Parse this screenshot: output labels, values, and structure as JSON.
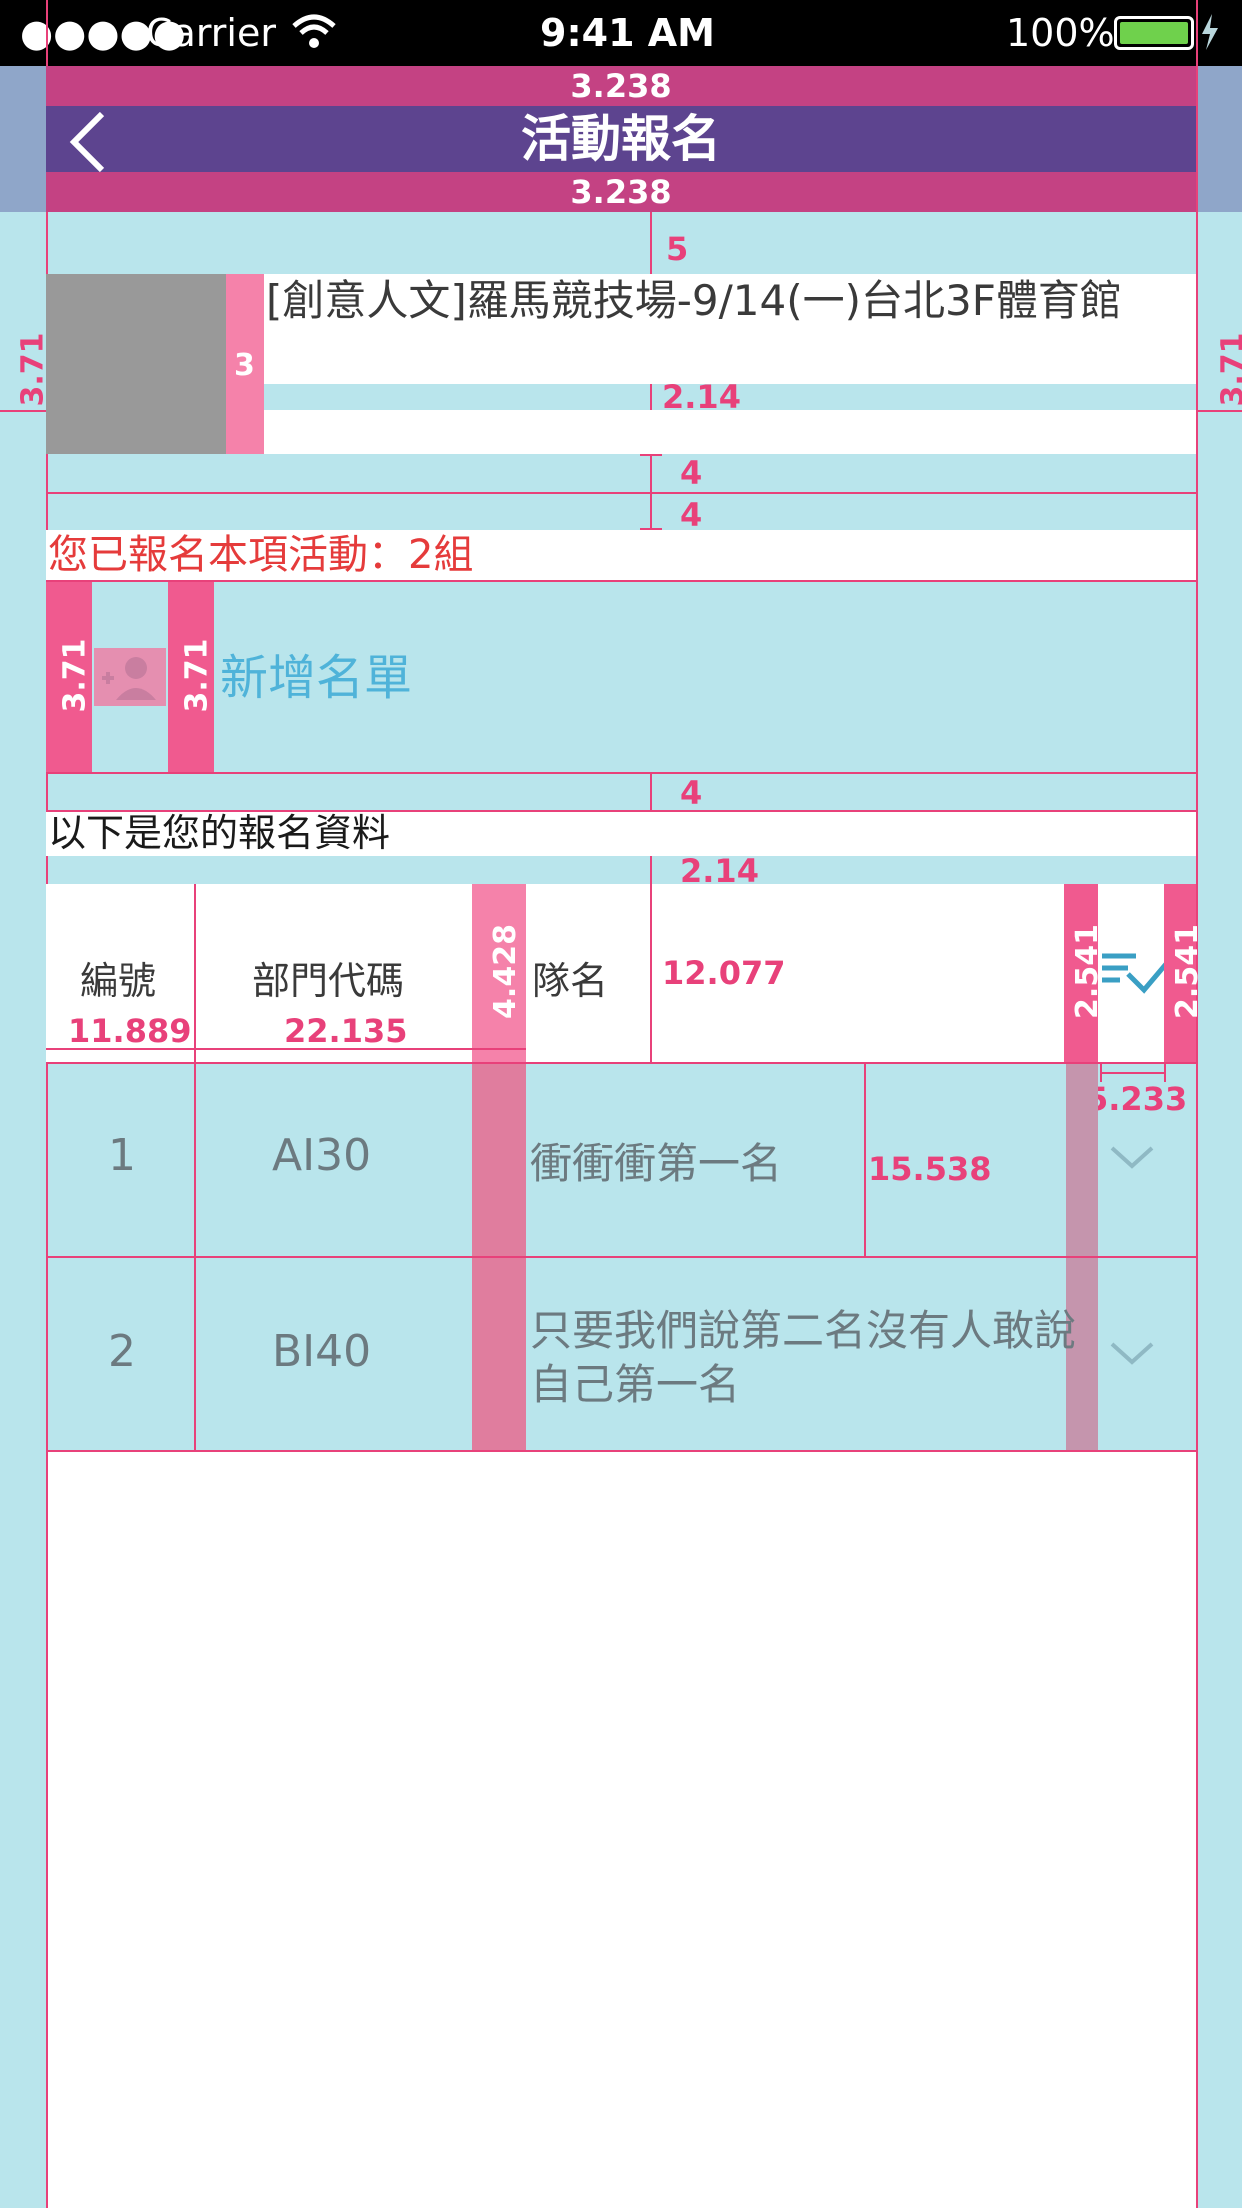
{
  "status_bar": {
    "carrier": "Carrier",
    "time": "9:41 AM",
    "battery": "100%"
  },
  "nav": {
    "title": "活動報名",
    "back_icon": "chevron-left-icon"
  },
  "event": {
    "title": "[創意人文]羅馬競技場-9/14(一)台北3F體育館"
  },
  "registered_notice": "您已報名本項活動：2組",
  "add_list": {
    "label": "新增名單",
    "icon": "add-person-icon"
  },
  "section_title": "以下是您的報名資料",
  "table": {
    "headers": {
      "number": "編號",
      "department": "部門代碼",
      "team": "隊名"
    },
    "rows": [
      {
        "number": "1",
        "department": "AI30",
        "team": "衝衝衝第一名"
      },
      {
        "number": "2",
        "department": "BI40",
        "team": "只要我們說第二名沒有人敢說自己第一名"
      }
    ]
  },
  "measurements": {
    "nav_top": "3.238",
    "nav_bottom": "3.238",
    "side_left": "3.71",
    "side_right": "3.71",
    "gap_top": "5",
    "thumb_gap": "3",
    "title_gap": "2.14",
    "gap_4a": "4",
    "gap_4b": "4",
    "icon_left": "3.71",
    "icon_right": "3.71",
    "gap_4c": "4",
    "gap_2_14": "2.14",
    "col_number": "11.889",
    "col_department": "22.135",
    "col_spacer": "4.428",
    "col_team": "12.077",
    "filter_left": "2.541",
    "filter_right": "2.541",
    "filter_width": "5.233",
    "row_height": "15.538"
  },
  "colors": {
    "nav_bg": "#5d448f",
    "guide_pink": "#e8417a",
    "background": "#b9e5ec",
    "notice_red": "#e53b3b",
    "link_blue": "#4fb3d9"
  }
}
